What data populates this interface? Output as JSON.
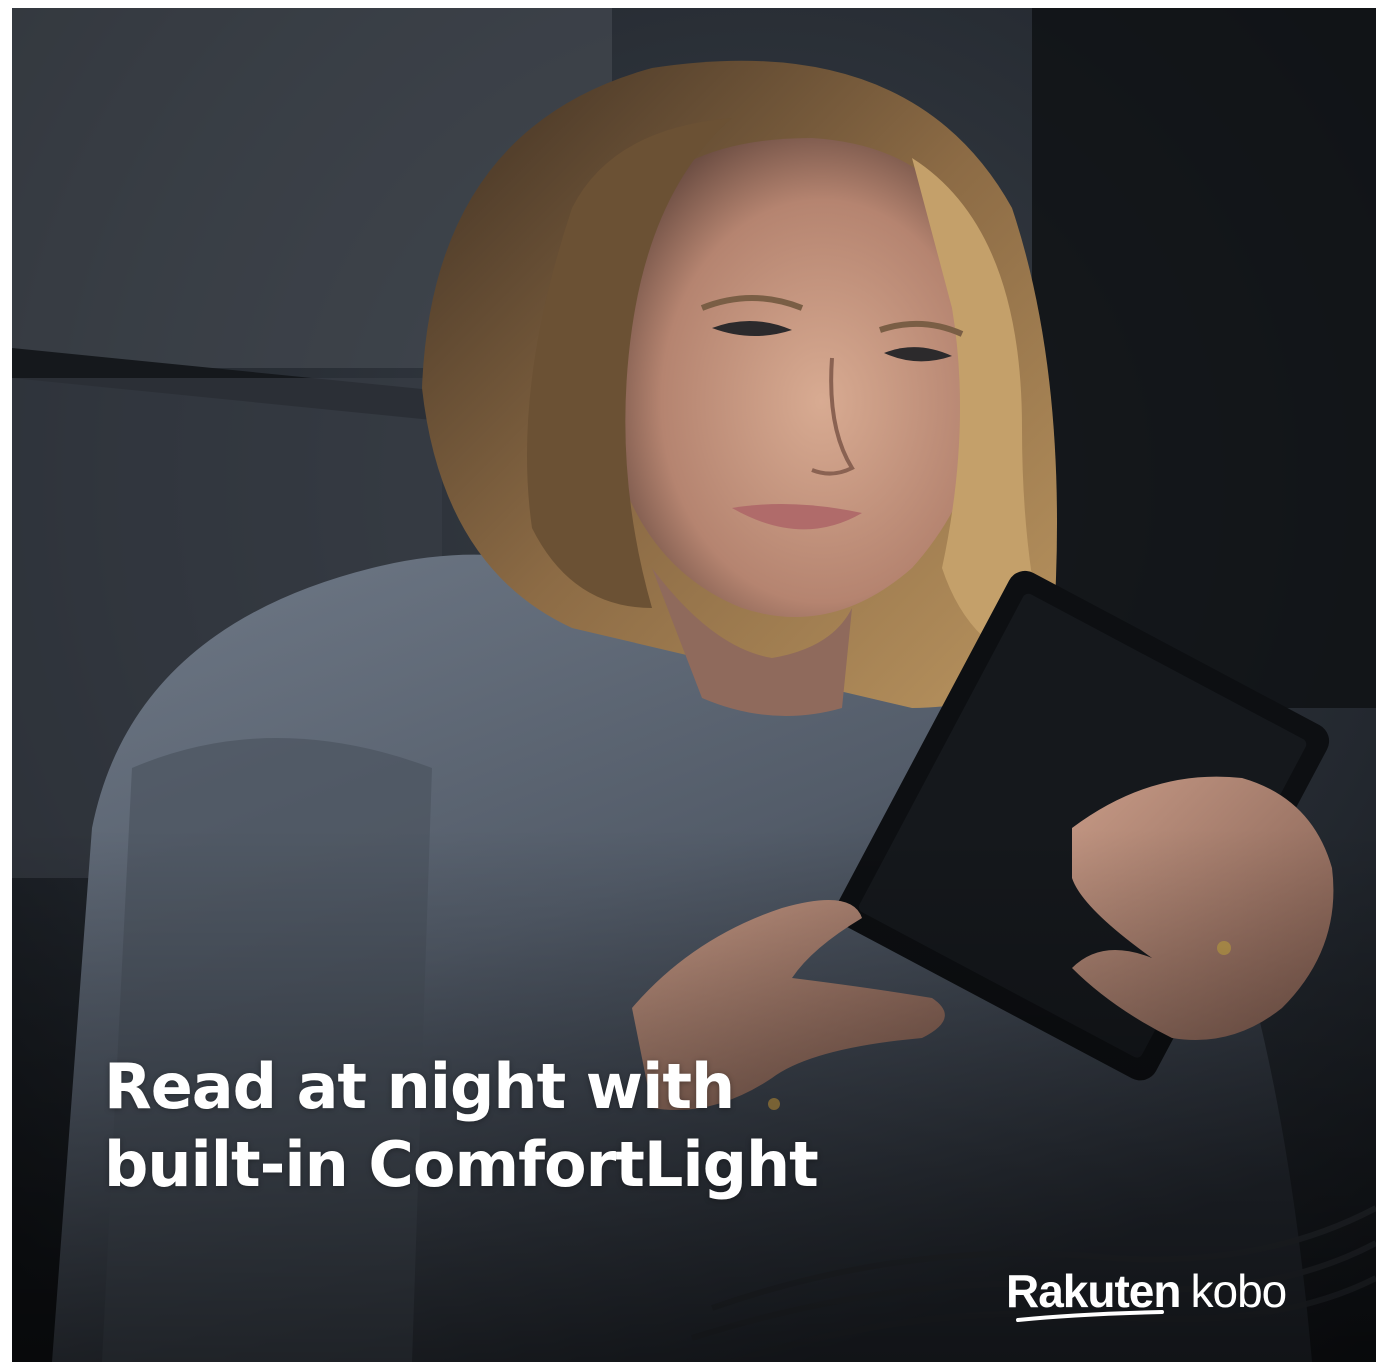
{
  "ad": {
    "headline_line1": "Read at night with",
    "headline_line2": "built-in ComfortLight",
    "logo_word1": "Rakuten",
    "logo_word2": "kobo"
  },
  "colors": {
    "text": "#ffffff",
    "background": "#1a1e24",
    "sweater": "#5d6775",
    "hair": "#8a6a44",
    "skin": "#c99a82"
  },
  "image": {
    "description_icon": "woman-reading-ereader-photo"
  }
}
